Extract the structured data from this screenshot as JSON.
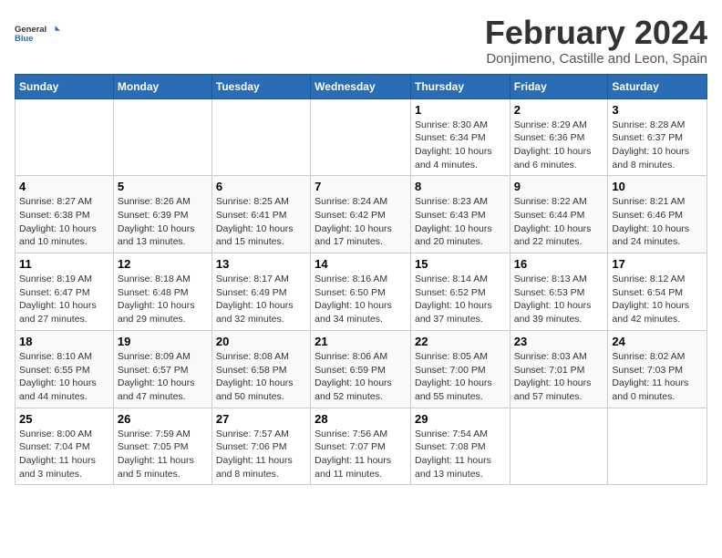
{
  "logo": {
    "general": "General",
    "blue": "Blue"
  },
  "title": "February 2024",
  "subtitle": "Donjimeno, Castille and Leon, Spain",
  "days_header": [
    "Sunday",
    "Monday",
    "Tuesday",
    "Wednesday",
    "Thursday",
    "Friday",
    "Saturday"
  ],
  "weeks": [
    [
      {
        "num": "",
        "detail": ""
      },
      {
        "num": "",
        "detail": ""
      },
      {
        "num": "",
        "detail": ""
      },
      {
        "num": "",
        "detail": ""
      },
      {
        "num": "1",
        "detail": "Sunrise: 8:30 AM\nSunset: 6:34 PM\nDaylight: 10 hours\nand 4 minutes."
      },
      {
        "num": "2",
        "detail": "Sunrise: 8:29 AM\nSunset: 6:36 PM\nDaylight: 10 hours\nand 6 minutes."
      },
      {
        "num": "3",
        "detail": "Sunrise: 8:28 AM\nSunset: 6:37 PM\nDaylight: 10 hours\nand 8 minutes."
      }
    ],
    [
      {
        "num": "4",
        "detail": "Sunrise: 8:27 AM\nSunset: 6:38 PM\nDaylight: 10 hours\nand 10 minutes."
      },
      {
        "num": "5",
        "detail": "Sunrise: 8:26 AM\nSunset: 6:39 PM\nDaylight: 10 hours\nand 13 minutes."
      },
      {
        "num": "6",
        "detail": "Sunrise: 8:25 AM\nSunset: 6:41 PM\nDaylight: 10 hours\nand 15 minutes."
      },
      {
        "num": "7",
        "detail": "Sunrise: 8:24 AM\nSunset: 6:42 PM\nDaylight: 10 hours\nand 17 minutes."
      },
      {
        "num": "8",
        "detail": "Sunrise: 8:23 AM\nSunset: 6:43 PM\nDaylight: 10 hours\nand 20 minutes."
      },
      {
        "num": "9",
        "detail": "Sunrise: 8:22 AM\nSunset: 6:44 PM\nDaylight: 10 hours\nand 22 minutes."
      },
      {
        "num": "10",
        "detail": "Sunrise: 8:21 AM\nSunset: 6:46 PM\nDaylight: 10 hours\nand 24 minutes."
      }
    ],
    [
      {
        "num": "11",
        "detail": "Sunrise: 8:19 AM\nSunset: 6:47 PM\nDaylight: 10 hours\nand 27 minutes."
      },
      {
        "num": "12",
        "detail": "Sunrise: 8:18 AM\nSunset: 6:48 PM\nDaylight: 10 hours\nand 29 minutes."
      },
      {
        "num": "13",
        "detail": "Sunrise: 8:17 AM\nSunset: 6:49 PM\nDaylight: 10 hours\nand 32 minutes."
      },
      {
        "num": "14",
        "detail": "Sunrise: 8:16 AM\nSunset: 6:50 PM\nDaylight: 10 hours\nand 34 minutes."
      },
      {
        "num": "15",
        "detail": "Sunrise: 8:14 AM\nSunset: 6:52 PM\nDaylight: 10 hours\nand 37 minutes."
      },
      {
        "num": "16",
        "detail": "Sunrise: 8:13 AM\nSunset: 6:53 PM\nDaylight: 10 hours\nand 39 minutes."
      },
      {
        "num": "17",
        "detail": "Sunrise: 8:12 AM\nSunset: 6:54 PM\nDaylight: 10 hours\nand 42 minutes."
      }
    ],
    [
      {
        "num": "18",
        "detail": "Sunrise: 8:10 AM\nSunset: 6:55 PM\nDaylight: 10 hours\nand 44 minutes."
      },
      {
        "num": "19",
        "detail": "Sunrise: 8:09 AM\nSunset: 6:57 PM\nDaylight: 10 hours\nand 47 minutes."
      },
      {
        "num": "20",
        "detail": "Sunrise: 8:08 AM\nSunset: 6:58 PM\nDaylight: 10 hours\nand 50 minutes."
      },
      {
        "num": "21",
        "detail": "Sunrise: 8:06 AM\nSunset: 6:59 PM\nDaylight: 10 hours\nand 52 minutes."
      },
      {
        "num": "22",
        "detail": "Sunrise: 8:05 AM\nSunset: 7:00 PM\nDaylight: 10 hours\nand 55 minutes."
      },
      {
        "num": "23",
        "detail": "Sunrise: 8:03 AM\nSunset: 7:01 PM\nDaylight: 10 hours\nand 57 minutes."
      },
      {
        "num": "24",
        "detail": "Sunrise: 8:02 AM\nSunset: 7:03 PM\nDaylight: 11 hours\nand 0 minutes."
      }
    ],
    [
      {
        "num": "25",
        "detail": "Sunrise: 8:00 AM\nSunset: 7:04 PM\nDaylight: 11 hours\nand 3 minutes."
      },
      {
        "num": "26",
        "detail": "Sunrise: 7:59 AM\nSunset: 7:05 PM\nDaylight: 11 hours\nand 5 minutes."
      },
      {
        "num": "27",
        "detail": "Sunrise: 7:57 AM\nSunset: 7:06 PM\nDaylight: 11 hours\nand 8 minutes."
      },
      {
        "num": "28",
        "detail": "Sunrise: 7:56 AM\nSunset: 7:07 PM\nDaylight: 11 hours\nand 11 minutes."
      },
      {
        "num": "29",
        "detail": "Sunrise: 7:54 AM\nSunset: 7:08 PM\nDaylight: 11 hours\nand 13 minutes."
      },
      {
        "num": "",
        "detail": ""
      },
      {
        "num": "",
        "detail": ""
      }
    ]
  ]
}
